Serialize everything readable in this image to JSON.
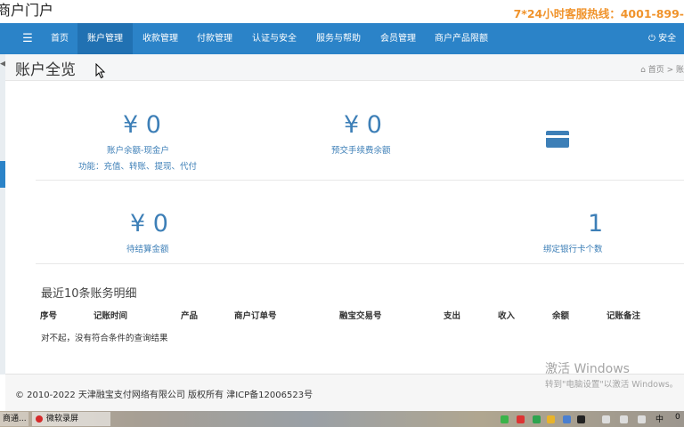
{
  "header": {
    "portal_title": "商户门户",
    "hotline": "7*24小时客服热线：4001-899-"
  },
  "nav": {
    "menu_icon": "☰",
    "items": [
      "首页",
      "账户管理",
      "收款管理",
      "付款管理",
      "认证与安全",
      "服务与帮助",
      "会员管理",
      "商户产品限额"
    ],
    "active_index": 1,
    "logout": "⏻ 安全"
  },
  "page": {
    "title": "账户全览",
    "breadcrumb": "⌂ 首页  >  账"
  },
  "summary": {
    "cash_balance": {
      "amount": "¥ 0",
      "label": "账户余额-现金户",
      "functions": "功能：充值、转账、提现、代付"
    },
    "prepaid_fee": {
      "amount": "¥ 0",
      "label": "预交手续费余额"
    },
    "pending_settlement": {
      "amount": "¥ 0",
      "label": "待结算金额"
    },
    "bound_cards": {
      "count": "1",
      "label": "绑定银行卡个数",
      "icon": "credit-card-icon"
    }
  },
  "recent": {
    "title": "最近10条账务明细",
    "columns": [
      "序号",
      "记账时间",
      "产品",
      "商户订单号",
      "融宝交易号",
      "支出",
      "收入",
      "余额",
      "记账备注"
    ],
    "empty_message": "对不起，没有符合条件的查询结果"
  },
  "footer": {
    "copyright": "© 2010-2022 天津融宝支付网络有限公司 版权所有 津ICP备12006523号"
  },
  "activation": {
    "title": "激活 Windows",
    "subtitle": "转到\"电脑设置\"以激活 Windows。"
  },
  "taskbar": {
    "task1": "商通...",
    "task2": "微软录屏",
    "ime": "中",
    "notification_count": "0"
  },
  "colors": {
    "nav_bg": "#2b83c8",
    "nav_active": "#2171b2",
    "accent_blue": "#3d7fb7",
    "hotline": "#f0932b"
  }
}
